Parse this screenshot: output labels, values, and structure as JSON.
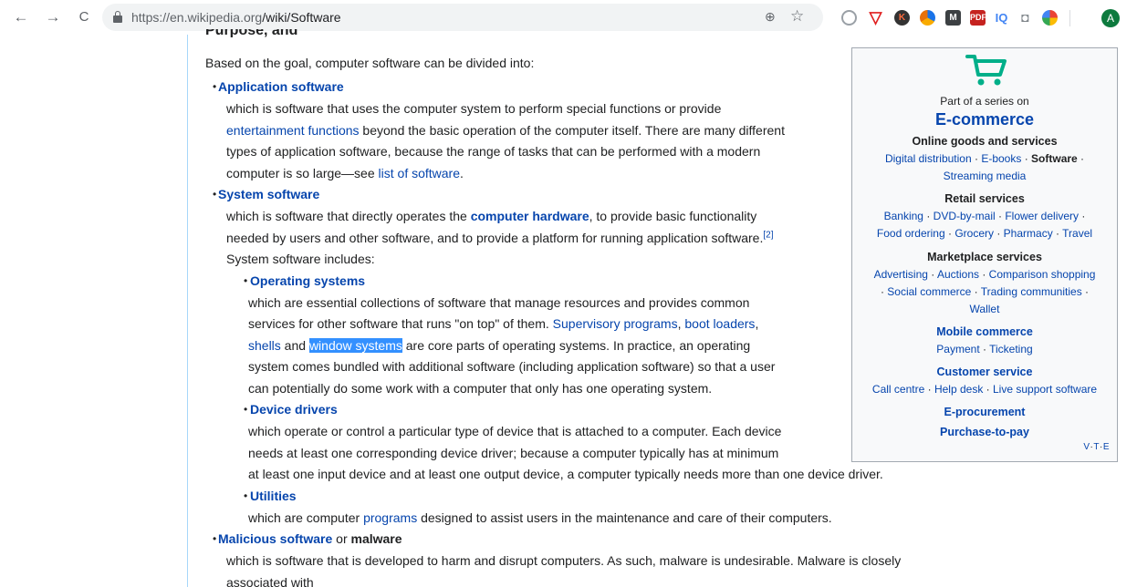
{
  "browser": {
    "back": "←",
    "forward": "→",
    "reload": "C",
    "url_host": "https://en.wikipedia.org",
    "url_path": "/wiki/Software",
    "zoom": "⊕",
    "star": "☆",
    "extensions": {
      "shield": "▽",
      "k": "K",
      "m": "M",
      "pdf": "PDF",
      "iq": "IQ",
      "camera": "◘"
    },
    "avatar": "A"
  },
  "article": {
    "cutoff_heading": "Purpose, and",
    "intro": "Based on the goal, computer software can be divided into:",
    "app": {
      "term": "Application software",
      "def1": "which is software that uses the computer system to perform special functions or provide",
      "link1": "entertainment functions",
      "def2": " beyond the basic operation of the computer itself. There are many different",
      "def3": "types of application software, because the range of tasks that can be performed with a modern",
      "def4": "computer is so large—see ",
      "link2": "list of software",
      "def5": "."
    },
    "sys": {
      "term": "System software",
      "def1": "which is software that directly operates the ",
      "link1": "computer hardware",
      "def2": ", to provide basic functionality",
      "def3": "needed by users and other software, and to provide a platform for running application software.",
      "ref": "[2]",
      "def4": "System software includes:"
    },
    "os": {
      "term": "Operating systems",
      "def1": "which are essential collections of software that manage resources and provides common",
      "def2": "services for other software that runs \"on top\" of them. ",
      "link1": "Supervisory programs",
      "sep1": ", ",
      "link2": "boot loaders",
      "sep2": ",",
      "link3": "shells",
      "and": " and ",
      "link4": "window systems",
      "def3": " are core parts of operating systems. In practice, an operating",
      "def4": "system comes bundled with additional software (including application software) so that a user",
      "def5": "can potentially do some work with a computer that only has one operating system."
    },
    "drivers": {
      "term": "Device drivers",
      "def1": "which operate or control a particular type of device that is attached to a computer. Each device",
      "def2": "needs at least one corresponding device driver; because a computer typically has at minimum",
      "def3": "at least one input device and at least one output device, a computer typically needs more than one device driver."
    },
    "utils": {
      "term": "Utilities",
      "def1": "which are computer ",
      "link1": "programs",
      "def2": " designed to assist users in the maintenance and care of their computers."
    },
    "malware": {
      "term": "Malicious software",
      "or": " or ",
      "bold": "malware",
      "def1": "which is software that is developed to harm and disrupt computers. As such, malware is undesirable. Malware is closely associated with"
    }
  },
  "infobox": {
    "series": "Part of a series on",
    "title": "E-commerce",
    "online": {
      "head": "Online goods and services",
      "i1": "Digital distribution",
      "i2": "E-books",
      "i3": "Software",
      "i4": "Streaming media"
    },
    "retail": {
      "head": "Retail services",
      "i1": "Banking",
      "i2": "DVD-by-mail",
      "i3": "Flower delivery",
      "i4": "Food ordering",
      "i5": "Grocery",
      "i6": "Pharmacy",
      "i7": "Travel"
    },
    "market": {
      "head": "Marketplace services",
      "i1": "Advertising",
      "i2": "Auctions",
      "i3": "Comparison shopping",
      "i4": "Social commerce",
      "i5": "Trading communities",
      "i6": "Wallet"
    },
    "mobile": {
      "head": "Mobile commerce",
      "i1": "Payment",
      "i2": "Ticketing"
    },
    "customer": {
      "head": "Customer service",
      "i1": "Call centre",
      "i2": "Help desk",
      "i3": "Live support software"
    },
    "eproc": "E-procurement",
    "p2p": "Purchase-to-pay",
    "separator": " · ",
    "vte": {
      "v": "V",
      "t": "T",
      "e": "E",
      "dot": "·"
    }
  },
  "colors": {
    "link": "#0645ad",
    "selection": "#3390ff",
    "cart": "#00af89"
  }
}
